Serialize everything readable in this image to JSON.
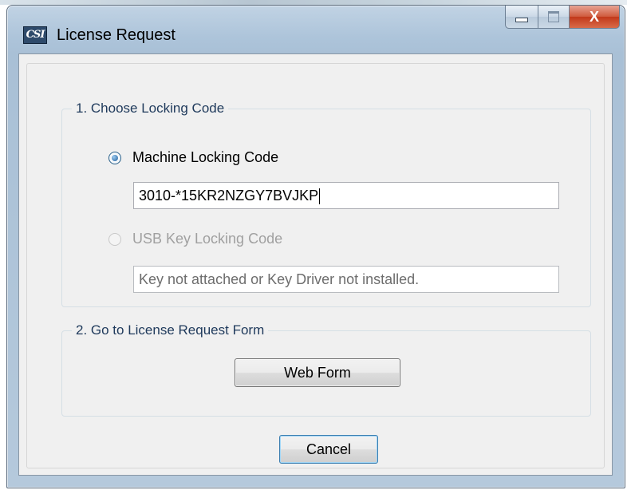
{
  "window": {
    "title": "License Request",
    "icon_text": "CSI",
    "icon_name": "csi-app-icon",
    "caption_buttons": [
      "minimize",
      "maximize",
      "close"
    ],
    "close_glyph": "X"
  },
  "group_locking": {
    "title": "1. Choose Locking Code",
    "machine_option": {
      "label": "Machine Locking Code",
      "selected": true,
      "value": "3010-*15KR2NZGY7BVJKP"
    },
    "usb_option": {
      "label": "USB Key Locking Code",
      "selected": false,
      "enabled": false,
      "value": "Key not attached or Key Driver not installed."
    }
  },
  "group_form": {
    "title": "2. Go to License Request Form",
    "web_form_label": "Web Form"
  },
  "footer": {
    "cancel_label": "Cancel"
  },
  "colors": {
    "group_title": "#1e395b",
    "frame": "#adc4da",
    "close_button": "#c2381a",
    "disabled_text": "#a0a0a0"
  }
}
